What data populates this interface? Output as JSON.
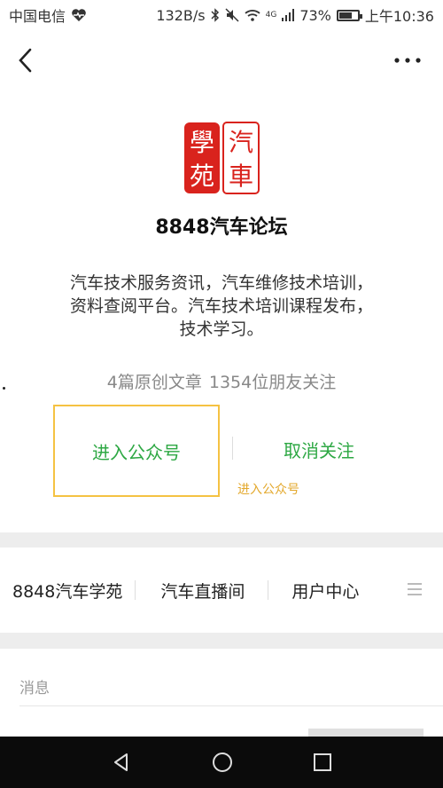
{
  "status_bar": {
    "carrier": "中国电信",
    "speed": "132B/s",
    "network": "4G",
    "battery": "73%",
    "battery_level": 0.73,
    "time": "上午10:36"
  },
  "header": {
    "back_icon": "chevron-left-icon",
    "more_icon": "more-dots-icon"
  },
  "profile": {
    "logo_text": [
      "學",
      "汽",
      "苑",
      "車"
    ],
    "name": "8848汽车论坛",
    "description": "汽车技术服务资讯，汽车维修技术培训，资料查阅平台。汽车技术培训课程发布，技术学习。",
    "stats": {
      "articles": "4篇原创文章",
      "followers": "1354位朋友关注"
    }
  },
  "actions": {
    "enter_label": "进入公众号",
    "unfollow_label": "取消关注",
    "hint_label": "进入公众号"
  },
  "menu": {
    "items": [
      "8848汽车学苑",
      "汽车直播间",
      "用户中心"
    ],
    "icon": "list-menu-icon"
  },
  "messages": {
    "title": "消息"
  },
  "colors": {
    "accent_green": "#2ea844",
    "highlight_yellow": "#f5c242",
    "logo_red": "#d9231d"
  }
}
